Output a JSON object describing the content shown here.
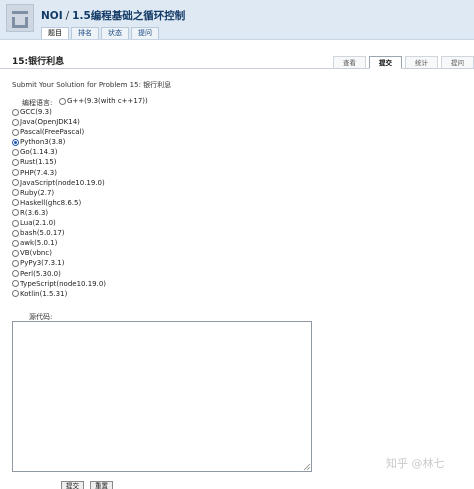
{
  "header": {
    "site": "NOI",
    "separator": "/",
    "section": "1.5编程基础之循环控制",
    "nav": [
      {
        "label": "题目",
        "active": true
      },
      {
        "label": "排名",
        "active": false
      },
      {
        "label": "状态",
        "active": false
      },
      {
        "label": "提问",
        "active": false
      }
    ]
  },
  "problem": {
    "title": "15:银行利息",
    "tabs": [
      {
        "label": "查看",
        "active": false
      },
      {
        "label": "提交",
        "active": true
      },
      {
        "label": "统计",
        "active": false
      },
      {
        "label": "提问",
        "active": false
      }
    ]
  },
  "form": {
    "submit_line": "Submit Your Solution for Problem 15: 银行利息",
    "lang_label": "编程语言:",
    "first_option": "G++(9.3(with c++17))",
    "languages": [
      {
        "label": "GCC(9.3)",
        "checked": false
      },
      {
        "label": "Java(OpenJDK14)",
        "checked": false
      },
      {
        "label": "Pascal(FreePascal)",
        "checked": false
      },
      {
        "label": "Python3(3.8)",
        "checked": true
      },
      {
        "label": "Go(1.14.3)",
        "checked": false
      },
      {
        "label": "Rust(1.15)",
        "checked": false
      },
      {
        "label": "PHP(7.4.3)",
        "checked": false
      },
      {
        "label": "JavaScript(node10.19.0)",
        "checked": false
      },
      {
        "label": "Ruby(2.7)",
        "checked": false
      },
      {
        "label": "Haskell(ghc8.6.5)",
        "checked": false
      },
      {
        "label": "R(3.6.3)",
        "checked": false
      },
      {
        "label": "Lua(2.1.0)",
        "checked": false
      },
      {
        "label": "bash(5.0.17)",
        "checked": false
      },
      {
        "label": "awk(5.0.1)",
        "checked": false
      },
      {
        "label": "VB(vbnc)",
        "checked": false
      },
      {
        "label": "PyPy3(7.3.1)",
        "checked": false
      },
      {
        "label": "Perl(5.30.0)",
        "checked": false
      },
      {
        "label": "TypeScript(node10.19.0)",
        "checked": false
      },
      {
        "label": "Kotlin(1.5.31)",
        "checked": false
      }
    ],
    "code_label": "源代码:",
    "code_value": "",
    "submit_button": "提交",
    "reset_button": "重置"
  },
  "watermark": "知乎 @林七",
  "colors": {
    "header_bg": "#dfe9f3",
    "title_color": "#123a66",
    "radio_checked": "#2a5db0"
  }
}
